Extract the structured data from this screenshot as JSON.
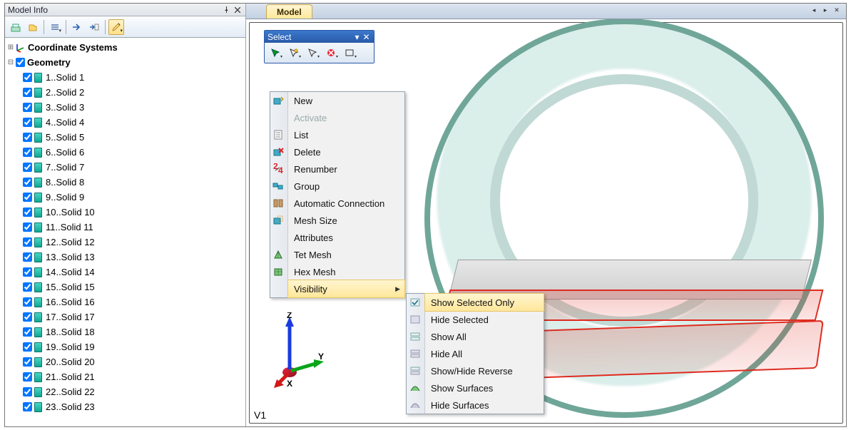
{
  "left_panel": {
    "title": "Model Info",
    "tree": {
      "root1": "Coordinate Systems",
      "root2": "Geometry",
      "solids": [
        "1..Solid 1",
        "2..Solid 2",
        "3..Solid 3",
        "4..Solid 4",
        "5..Solid 5",
        "6..Solid 6",
        "7..Solid 7",
        "8..Solid 8",
        "9..Solid 9",
        "10..Solid 10",
        "11..Solid 11",
        "12..Solid 12",
        "13..Solid 13",
        "14..Solid 14",
        "15..Solid 15",
        "16..Solid 16",
        "17..Solid 17",
        "18..Solid 18",
        "19..Solid 19",
        "20..Solid 20",
        "21..Solid 21",
        "22..Solid 22",
        "23..Solid 23"
      ]
    }
  },
  "right_panel": {
    "tab": "Model",
    "float_toolbar_title": "Select",
    "view_label": "V1",
    "triad": {
      "x": "X",
      "y": "Y",
      "z": "Z"
    }
  },
  "context_menu": {
    "items": [
      "New",
      "Activate",
      "List",
      "Delete",
      "Renumber",
      "Group",
      "Automatic Connection",
      "Mesh Size",
      "Attributes",
      "Tet Mesh",
      "Hex Mesh",
      "Visibility"
    ],
    "disabled_index": 1,
    "highlight_index": 11,
    "submenu": [
      "Show Selected Only",
      "Hide Selected",
      "Show All",
      "Hide All",
      "Show/Hide Reverse",
      "Show Surfaces",
      "Hide Surfaces"
    ],
    "sub_highlight_index": 0
  }
}
